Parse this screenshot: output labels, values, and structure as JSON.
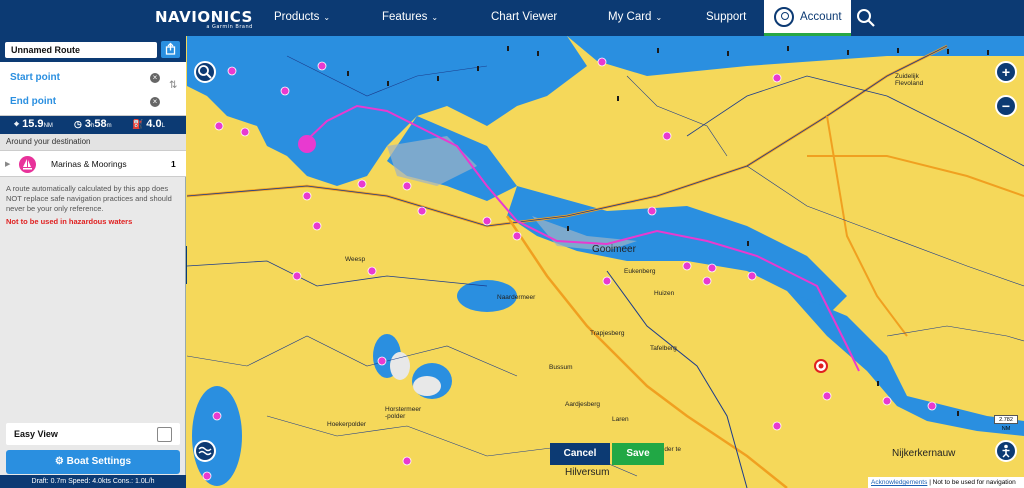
{
  "nav": {
    "logo": "NAVIONICS",
    "logo_sub": "a Garmin Brand",
    "items": [
      {
        "label": "Products",
        "dropdown": true
      },
      {
        "label": "Features",
        "dropdown": true
      },
      {
        "label": "Chart Viewer",
        "dropdown": false
      },
      {
        "label": "My Card",
        "dropdown": true
      },
      {
        "label": "Support",
        "dropdown": false
      }
    ],
    "account_label": "Account"
  },
  "route": {
    "name": "Unnamed Route",
    "start_label": "Start point",
    "end_label": "End point",
    "distance": "15.9",
    "distance_unit": "NM",
    "time_h": "3",
    "time_h_unit": "h",
    "time_m": "58",
    "time_m_unit": "m",
    "fuel": "4.0",
    "fuel_unit": "L"
  },
  "around": {
    "heading": "Around your destination",
    "items": [
      {
        "label": "Marinas & Moorings",
        "count": "1"
      }
    ]
  },
  "disclaimer": "A route automatically calculated by this app does NOT replace safe navigation practices and should never be your only reference.",
  "warning": "Not to be used in hazardous waters",
  "easy_view_label": "Easy View",
  "boat_settings_label": "Boat Settings",
  "boat_info": "Draft: 0.7m Speed: 4.0kts Cons.: 1.0L/h",
  "map": {
    "places": {
      "goimeer": "Gooimeer",
      "eukenberg": "Eukenberg",
      "huizen": "Huizen",
      "naardermeer": "Naardermeer",
      "trapjesberg": "Trapjesberg",
      "tafelberg": "Tafelberg",
      "bussum": "Bussum",
      "aardjesberg": "Aardjesberg",
      "laren": "Laren",
      "hilversum": "Hilversum",
      "nijkerkernauw": "Nijkerkernauw",
      "zuidelijk_flevoland": "Zuidelijk Flevoland",
      "weesp": "Weesp",
      "hoekerpolder": "Hoekerpolder",
      "horstermeer": "Horstermeer -polder",
      "zuidpolder": "Zuidpolder te Veen"
    },
    "scale": "2.782 NM",
    "cancel_label": "Cancel",
    "save_label": "Save",
    "footer_ack": "Acknowledgements",
    "footer_text": "| Not to be used for navigation"
  },
  "colors": {
    "nav_bg": "#0c3a73",
    "land": "#f5d85a",
    "water": "#2a8fe0",
    "route": "#e83ad0",
    "save": "#21a845"
  }
}
